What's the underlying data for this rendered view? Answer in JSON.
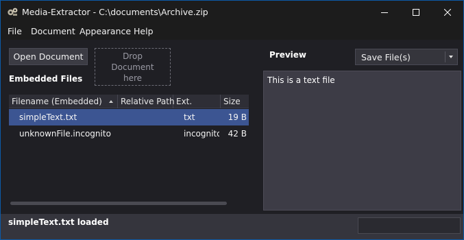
{
  "window": {
    "title": "Media-Extractor - C:\\documents\\Archive.zip",
    "icon": "gears-icon",
    "frame_color": "#0c5aa8",
    "background": "#1f1f24"
  },
  "menu": [
    "File",
    "Document",
    "Appearance",
    "Help"
  ],
  "toolbar": {
    "open_label": "Open Document",
    "drop_label": "Drop Document here"
  },
  "files": {
    "title": "Embedded Files",
    "columns": [
      "Filename (Embedded)",
      "Relative Path",
      "Ext.",
      "Size"
    ],
    "sort_column": "Filename (Embedded)",
    "sort_direction": "ascending",
    "rows": [
      {
        "name": "simpleText.txt",
        "path": "",
        "ext": "txt",
        "size": "19 B",
        "selected": true
      },
      {
        "name": "unknownFile.incognito",
        "path": "",
        "ext": "incognito",
        "size": "42 B",
        "selected": false
      }
    ],
    "selected_color": "#3c5592"
  },
  "preview": {
    "title": "Preview",
    "save_label": "Save File(s)",
    "content": "This is a text file"
  },
  "status": {
    "message": "simpleText.txt loaded",
    "field_value": ""
  }
}
